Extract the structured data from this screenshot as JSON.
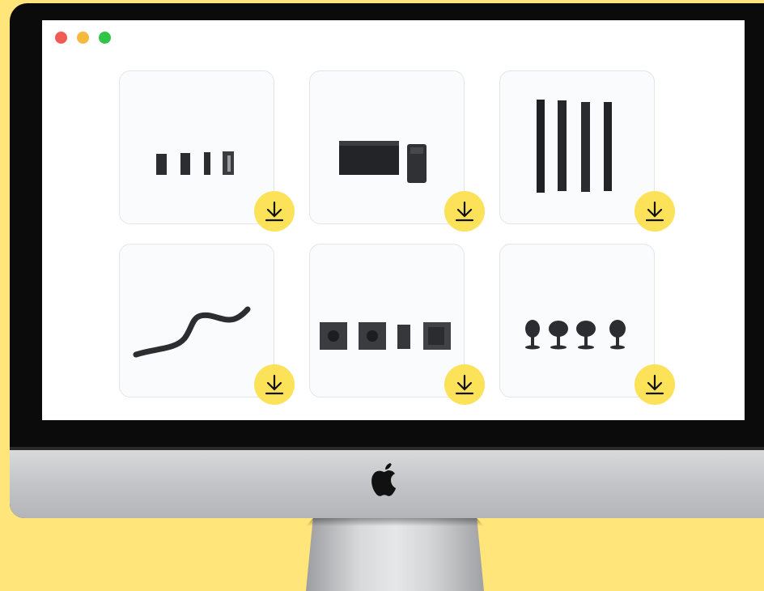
{
  "window": {
    "controls": [
      "close",
      "minimize",
      "zoom"
    ]
  },
  "gallery": {
    "items": [
      {
        "product_icon": "compact-speakers-icon",
        "action_icon": "download-icon"
      },
      {
        "product_icon": "subwoofer-amplifier-icon",
        "action_icon": "download-icon"
      },
      {
        "product_icon": "column-speakers-icon",
        "action_icon": "download-icon"
      },
      {
        "product_icon": "cable-icon",
        "action_icon": "download-icon"
      },
      {
        "product_icon": "ceiling-speakers-icon",
        "action_icon": "download-icon"
      },
      {
        "product_icon": "mounted-speakers-icon",
        "action_icon": "download-icon"
      }
    ]
  },
  "colors": {
    "background": "#FFE57A",
    "download_button": "#FBE258",
    "product": "#2b2d30"
  }
}
